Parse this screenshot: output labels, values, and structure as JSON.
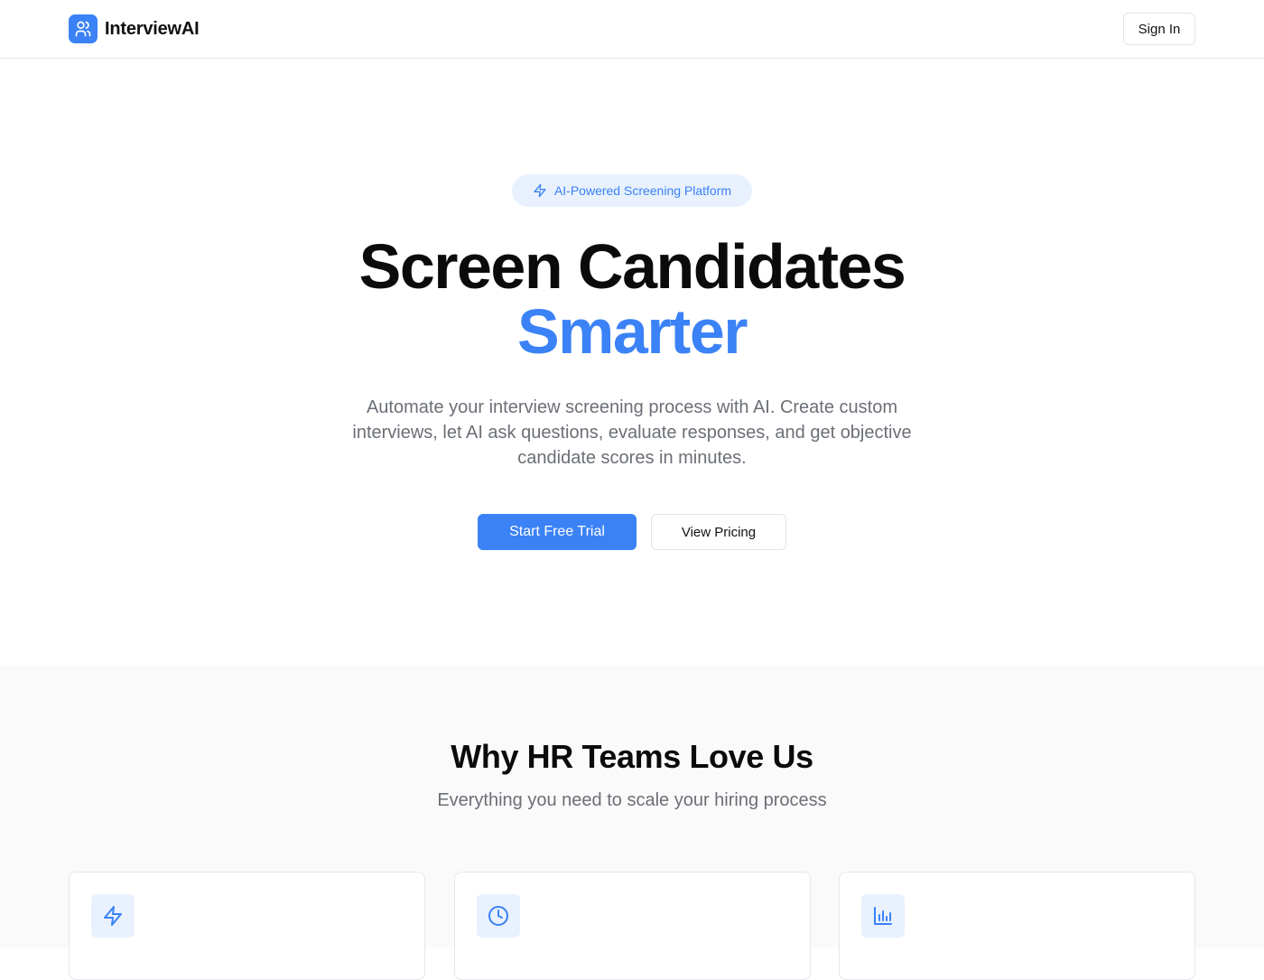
{
  "nav": {
    "brand_name": "InterviewAI",
    "sign_in_label": "Sign In"
  },
  "hero": {
    "badge_text": "AI-Powered Screening Platform",
    "title_line1": "Screen Candidates",
    "title_line2": "Smarter",
    "subtitle": "Automate your interview screening process with AI. Create custom interviews, let AI ask questions, evaluate responses, and get objective candidate scores in minutes.",
    "primary_cta": "Start Free Trial",
    "secondary_cta": "View Pricing"
  },
  "features": {
    "title": "Why HR Teams Love Us",
    "subtitle": "Everything you need to scale your hiring process",
    "cards": [
      {
        "icon": "lightning-icon"
      },
      {
        "icon": "clock-icon"
      },
      {
        "icon": "bar-chart-icon"
      }
    ]
  },
  "colors": {
    "accent": "#3b82f6",
    "accent_soft": "#e8f1fd",
    "muted_text": "#6b6f76",
    "section_bg": "#fafafa"
  }
}
